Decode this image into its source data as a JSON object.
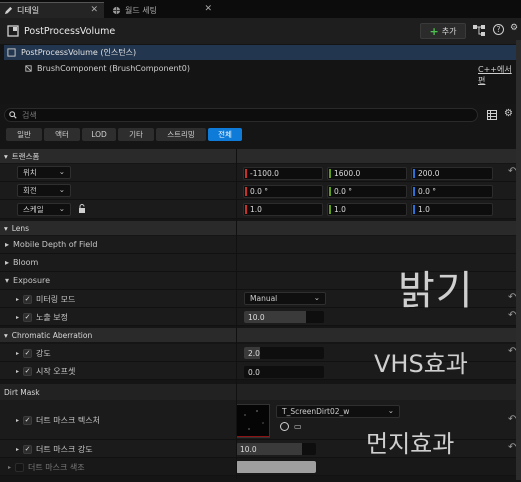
{
  "tabs": [
    {
      "label": "디테일",
      "active": true
    },
    {
      "label": "월드 세팅",
      "active": false
    }
  ],
  "header": {
    "title": "PostProcessVolume",
    "add_label": "추가"
  },
  "components": {
    "root": "PostProcessVolume (인스턴스)",
    "child": "BrushComponent (BrushComponent0)",
    "cpp_link": "C++에서 편"
  },
  "search": {
    "placeholder": "검색"
  },
  "filters": [
    {
      "label": "일반",
      "active": false
    },
    {
      "label": "액터",
      "active": false
    },
    {
      "label": "LOD",
      "active": false
    },
    {
      "label": "기타",
      "active": false
    },
    {
      "label": "스트리밍",
      "active": false
    },
    {
      "label": "전체",
      "active": true
    }
  ],
  "transform": {
    "category": "트랜스폼",
    "location": {
      "label": "위치",
      "x": "-1100.0",
      "y": "1600.0",
      "z": "200.0"
    },
    "rotation": {
      "label": "회전",
      "x": "0.0 °",
      "y": "0.0 °",
      "z": "0.0 °"
    },
    "scale": {
      "label": "스케일",
      "x": "1.0",
      "y": "1.0",
      "z": "1.0"
    }
  },
  "sections": {
    "lens": "Lens",
    "mobile_dof": "Mobile Depth of Field",
    "bloom": "Bloom",
    "exposure": "Exposure",
    "chromatic": "Chromatic Aberration",
    "dirt_mask": "Dirt Mask"
  },
  "exposure": {
    "metering_label": "미터링 모드",
    "metering_value": "Manual",
    "comp_label": "노출 보정",
    "comp_value": "10.0"
  },
  "chromatic": {
    "intensity_label": "강도",
    "intensity_value": "2.0",
    "start_label": "시작 오프셋",
    "start_value": "0.0"
  },
  "dirt": {
    "texture_label": "더트 마스크 텍스처",
    "texture_value": "T_ScreenDirt02_w",
    "intensity_label": "더트 마스크 강도",
    "intensity_value": "10.0",
    "tint_label": "더트 마스크 색조"
  },
  "annotations": {
    "brightness": "밝기",
    "vhs": "VHS효과",
    "dust": "먼지효과"
  }
}
